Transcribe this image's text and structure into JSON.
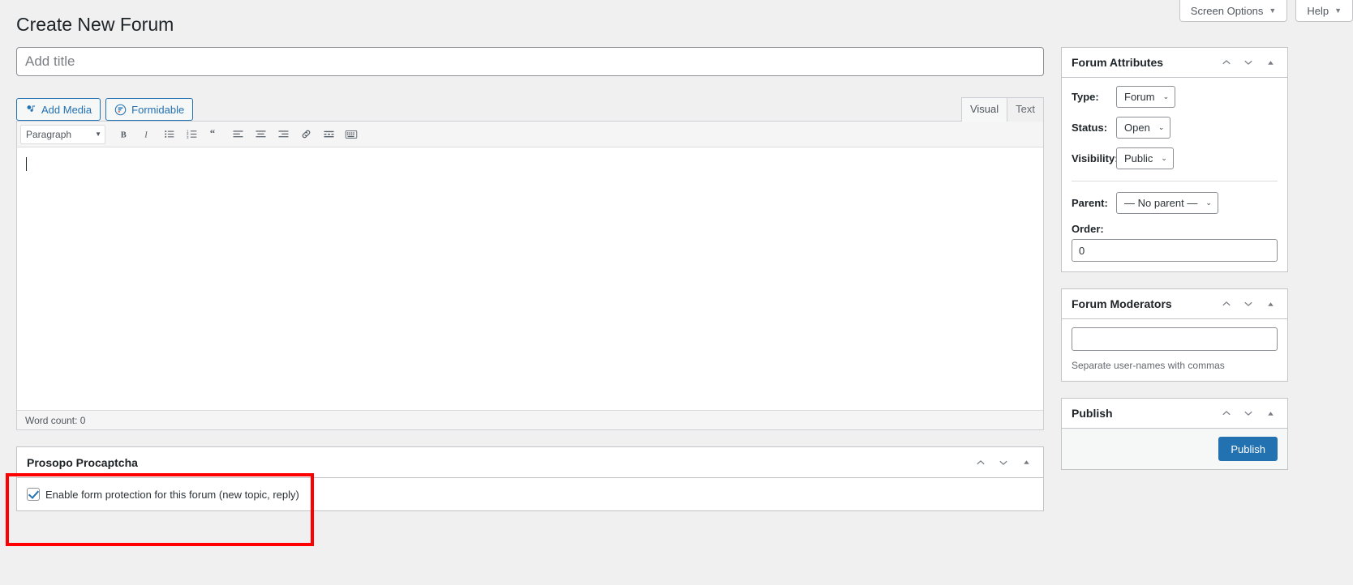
{
  "topbar": {
    "screen_options_label": "Screen Options",
    "help_label": "Help",
    "caret": "▼"
  },
  "page": {
    "title": "Create New Forum"
  },
  "title_field": {
    "placeholder": "Add title",
    "value": ""
  },
  "media_buttons": {
    "add_media_label": "Add Media",
    "formidable_label": "Formidable"
  },
  "editor": {
    "tabs": [
      {
        "label": "Visual",
        "active": true
      },
      {
        "label": "Text",
        "active": false
      }
    ],
    "format_select": "Paragraph",
    "format_caret": "▼",
    "toolbar_icons": [
      "bold-icon",
      "italic-icon",
      "bulleted-list-icon",
      "numbered-list-icon",
      "blockquote-icon",
      "align-left-icon",
      "align-center-icon",
      "align-right-icon",
      "insert-link-icon",
      "read-more-icon",
      "toolbar-toggle-icon"
    ],
    "content": "",
    "status": "Word count: 0"
  },
  "procaptcha_metabox": {
    "title": "Prosopo Procaptcha",
    "checkbox_label": "Enable form protection for this forum (new topic, reply)",
    "checkbox_checked": true,
    "highlight_color": "#ff0000"
  },
  "sidebar": {
    "forum_attributes": {
      "title": "Forum Attributes",
      "type_label": "Type:",
      "type_value": "Forum",
      "status_label": "Status:",
      "status_value": "Open",
      "visibility_label": "Visibility:",
      "visibility_value": "Public",
      "parent_label": "Parent:",
      "parent_value": "— No parent —",
      "order_label": "Order:",
      "order_value": "0"
    },
    "forum_moderators": {
      "title": "Forum Moderators",
      "input_value": "",
      "hint": "Separate user-names with commas"
    },
    "publish": {
      "title": "Publish",
      "button_label": "Publish"
    }
  },
  "colors": {
    "accent": "#2271b1",
    "page_bg": "#f0f0f1",
    "border": "#c3c4c7"
  }
}
